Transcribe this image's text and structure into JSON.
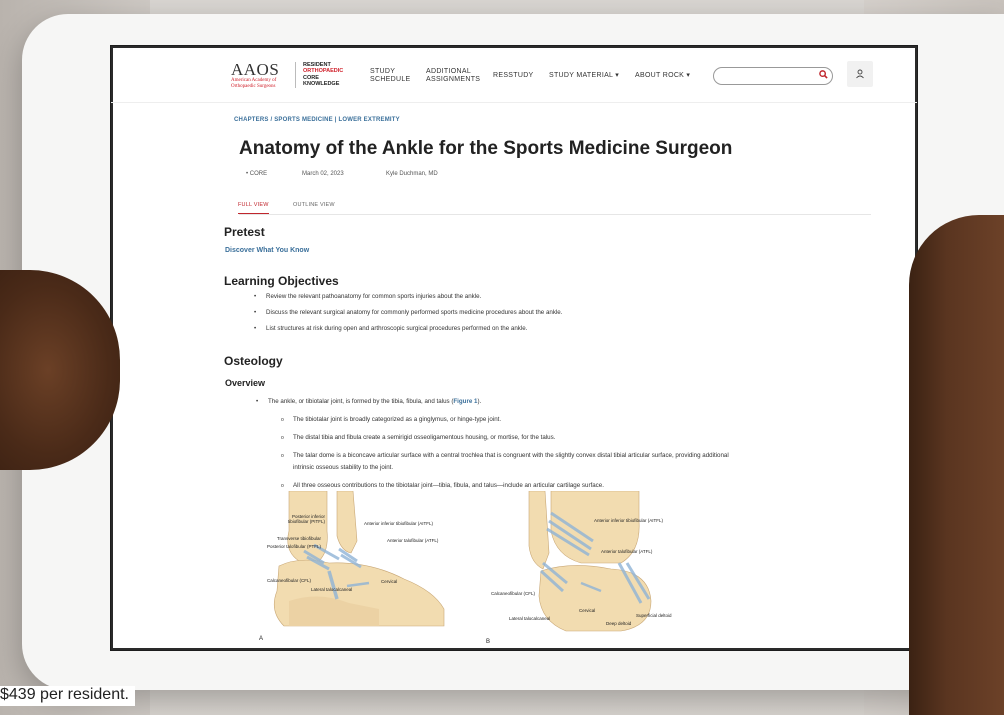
{
  "header": {
    "logo_primary": "AAOS",
    "logo_sub": "American Academy of Orthopaedic Surgeons",
    "logo_rock_line1": "RESIDENT",
    "logo_rock_line2": "ORTHOPAEDIC",
    "logo_rock_line3": "CORE",
    "logo_rock_line4": "KNOWLEDGE",
    "nav": [
      {
        "line1": "STUDY",
        "line2": "SCHEDULE"
      },
      {
        "line1": "ADDITIONAL",
        "line2": "ASSIGNMENTS"
      },
      {
        "line1": "RESSTUDY",
        "line2": ""
      },
      {
        "line1": "STUDY MATERIAL ▾",
        "line2": ""
      },
      {
        "line1": "ABOUT ROCK ▾",
        "line2": ""
      }
    ],
    "search_icon": "search-icon",
    "user_icon": "user-icon"
  },
  "article": {
    "breadcrumb": "CHAPTERS / SPORTS MEDICINE | LOWER EXTREMITY",
    "title": "Anatomy of the Ankle for the Sports Medicine Surgeon",
    "tag": "• CORE",
    "date": "March 02, 2023",
    "author": "Kyle Duchman, MD",
    "tabs": [
      "FULL VIEW",
      "OUTLINE VIEW"
    ],
    "pretest_heading": "Pretest",
    "pretest_link": "Discover What You Know",
    "objectives_heading": "Learning Objectives",
    "objectives": [
      "Review the relevant pathoanatomy for common sports injuries about the ankle.",
      "Discuss the relevant surgical anatomy for commonly performed sports medicine procedures about the ankle.",
      "List structures at risk during open and arthroscopic surgical procedures performed on the ankle."
    ],
    "osteology_heading": "Osteology",
    "overview_heading": "Overview",
    "overview_main_pre": "The ankle, or tibiotalar joint, is formed by the tibia, fibula, and talus (",
    "overview_main_link": "Figure 1",
    "overview_main_post": ").",
    "overview_sub": [
      "The tibiotalar joint is broadly categorized as a ginglymus, or hinge-type joint.",
      "The distal tibia and fibula create a semirigid osseoligamentous housing, or mortise, for the talus.",
      "The talar dome is a biconcave articular surface with a central trochlea that is congruent with the slightly convex distal tibial articular surface, providing additional",
      "intrinsic osseous stability to the joint.",
      "All three osseous contributions to the tibiotalar joint—tibia, fibula, and talus—include an articular cartilage surface."
    ],
    "figure_a": {
      "letter": "A",
      "labels": [
        "Posterior inferior",
        "tibiofibular (PITFL)",
        "Transverse tibiofibular",
        "Posterior talofibular (PTFL)",
        "Anterior inferior tibiofibular (AITFL)",
        "Anterior talofibular (ATFL)",
        "Calcaneofibular (CFL)",
        "Lateral talocalcaneal",
        "Cervical"
      ]
    },
    "figure_b": {
      "letter": "B",
      "labels": [
        "Anterior inferior tibiofibular (AITFL)",
        "Anterior talofibular (ATFL)",
        "Calcaneofibular (CFL)",
        "Cervical",
        "Lateral talocalcaneal",
        "Superficial deltoid",
        "Deep deltoid"
      ]
    }
  },
  "caption": "$439 per resident.",
  "colors": {
    "accent": "#c0262d",
    "link": "#3a6f9a"
  }
}
